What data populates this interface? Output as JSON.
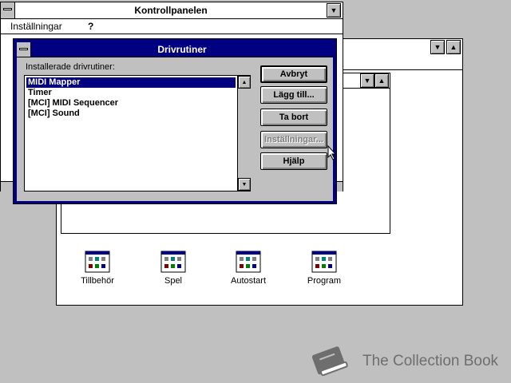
{
  "control_panel": {
    "title": "Kontrollpanelen",
    "menu": [
      {
        "label": "Inställningar"
      },
      {
        "label": "?"
      }
    ]
  },
  "program_manager": {
    "groups": [
      {
        "label": "Tillbehör",
        "icon": "program-group-icon"
      },
      {
        "label": "Spel",
        "icon": "program-group-icon"
      },
      {
        "label": "Autostart",
        "icon": "program-group-icon"
      },
      {
        "label": "Program",
        "icon": "program-group-icon"
      }
    ]
  },
  "dialog": {
    "title": "Drivrutiner",
    "list_label": "Installerade drivrutiner:",
    "drivers": [
      "MIDI Mapper",
      "Timer",
      "[MCI] MIDI Sequencer",
      "[MCI] Sound"
    ],
    "selected_index": 0,
    "buttons": {
      "cancel": "Avbryt",
      "add": "Lägg till...",
      "remove": "Ta bort",
      "setup": "Inställningar...",
      "help": "Hjälp"
    }
  },
  "watermark": {
    "text": "The Collection Book",
    "icon": "book-icon"
  },
  "colors": {
    "desktop": "#c0c0c0",
    "titlebar_active": "#000080",
    "selection": "#000080"
  }
}
